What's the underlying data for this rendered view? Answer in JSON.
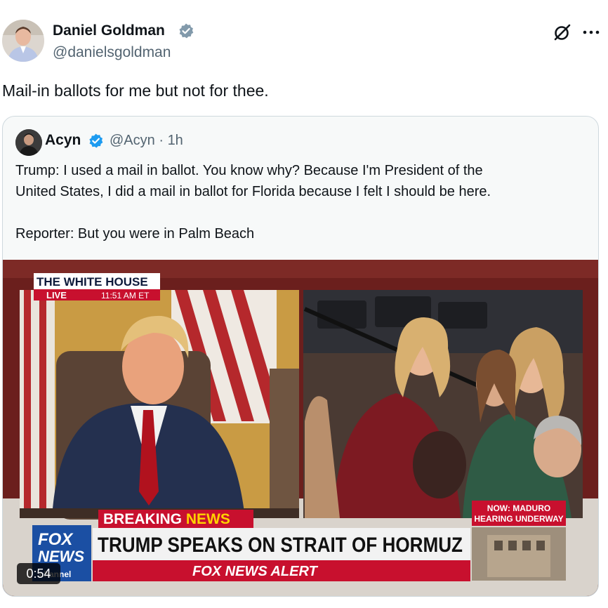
{
  "post": {
    "author_name": "Daniel Goldman",
    "author_handle": "@danielsgoldman",
    "text": "Mail-in ballots for me but not for thee."
  },
  "quote": {
    "author_name": "Acyn",
    "author_handle": "@Acyn",
    "separator": "·",
    "time": "1h",
    "line1": "Trump: I used a mail in ballot. You know why? Because I'm President of the",
    "line2": "United States, I did a mail in ballot for Florida because I felt I should be here.",
    "line3": "Reporter: But you were in Palm Beach"
  },
  "video": {
    "duration": "0:54",
    "location_label": "THE WHITE HOUSE",
    "live_label": "LIVE",
    "time_label": "11:51 AM ET",
    "breaking_word": "BREAKING",
    "news_word": "NEWS",
    "headline": "TRUMP SPEAKS ON STRAIT OF HORMUZ",
    "alert_label": "FOX NEWS ALERT",
    "side_line1": "NOW: MADURO",
    "side_line2": "HEARING UNDERWAY",
    "logo_fox": "FOX",
    "logo_news": "NEWS",
    "logo_channel": "channel"
  },
  "icons": {
    "verified": "verified-badge-icon",
    "grok": "grok-icon",
    "more": "more-options-icon"
  },
  "colors": {
    "verified_blue": "#1d9bf0",
    "fox_red": "#c8102e",
    "fox_yellow": "#ffd200",
    "fox_blue": "#1b4fa3"
  }
}
